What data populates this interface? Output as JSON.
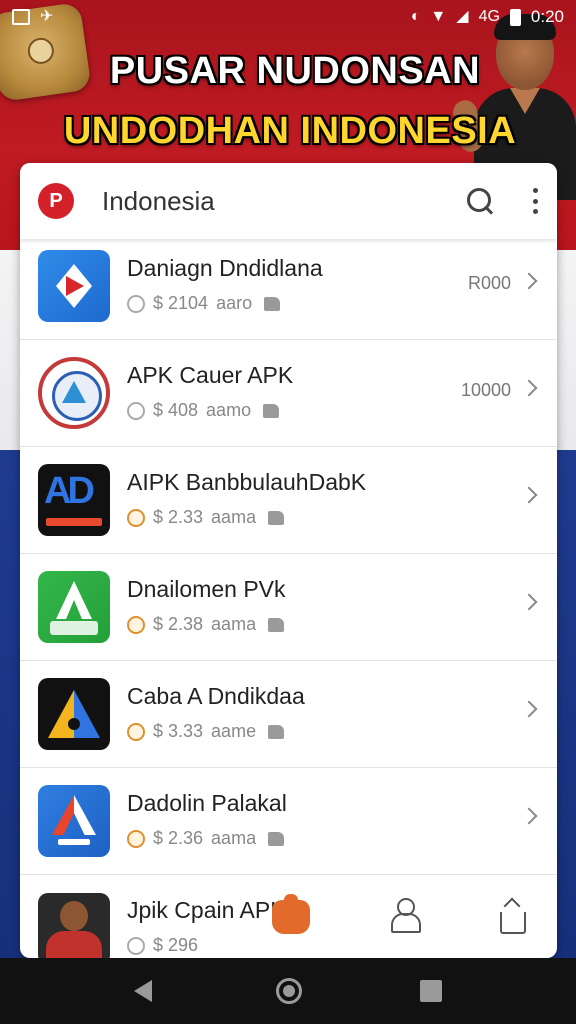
{
  "status_bar": {
    "time": "0:20",
    "signal_text": "4G",
    "icons": [
      "gallery-icon",
      "bird-icon",
      "vibrate-icon",
      "wifi-icon",
      "signal-icon",
      "battery-icon"
    ]
  },
  "banner": {
    "headline_1": "PUSAR NUDONSAN",
    "headline_2": "UNDODHAN INDONESIA",
    "colors": {
      "red": "#c01b22",
      "white": "#f4f4f4",
      "blue": "#1f3b8f",
      "yellow": "#ffd62e"
    }
  },
  "app_bar": {
    "logo_letter": "P",
    "title": "Indonesia",
    "icons": [
      "search-icon",
      "more-vert-icon"
    ]
  },
  "list": [
    {
      "title": "Daniagn Dndidlana",
      "price": "$ 2104",
      "meta": "aaro",
      "right": "R000",
      "icon": "apk-play-icon",
      "meta_icon": "grey"
    },
    {
      "title": "APK Cauer APK",
      "price": "$ 408",
      "meta": "aamo",
      "right": "10000",
      "icon": "apk-circle-icon",
      "meta_icon": "grey"
    },
    {
      "title": "AIPK BanbbulauhDabK",
      "price": "$ 2.33",
      "meta": "aama",
      "right": "",
      "icon": "ad-icon",
      "meta_icon": "orange"
    },
    {
      "title": "Dnailomen PVk",
      "price": "$ 2.38",
      "meta": "aama",
      "right": "",
      "icon": "apk-green-icon",
      "meta_icon": "orange"
    },
    {
      "title": "Caba A Dndikdaa",
      "price": "$ 3.33",
      "meta": "aame",
      "right": "",
      "icon": "apk-dark-icon",
      "meta_icon": "orange"
    },
    {
      "title": "Dadolin Palakal",
      "price": "$ 2.36",
      "meta": "aama",
      "right": "",
      "icon": "apk-blue-icon",
      "meta_icon": "orange"
    },
    {
      "title": "Jpik Cpain APK",
      "price": "$ 296",
      "meta": "",
      "right": "",
      "icon": "apk-person-icon",
      "meta_icon": "grey"
    }
  ],
  "bottom_tabs": [
    "home-icon",
    "people-icon",
    "share-icon"
  ],
  "nav_bar": [
    "back-icon",
    "home-circle-icon",
    "recent-apps-icon"
  ]
}
